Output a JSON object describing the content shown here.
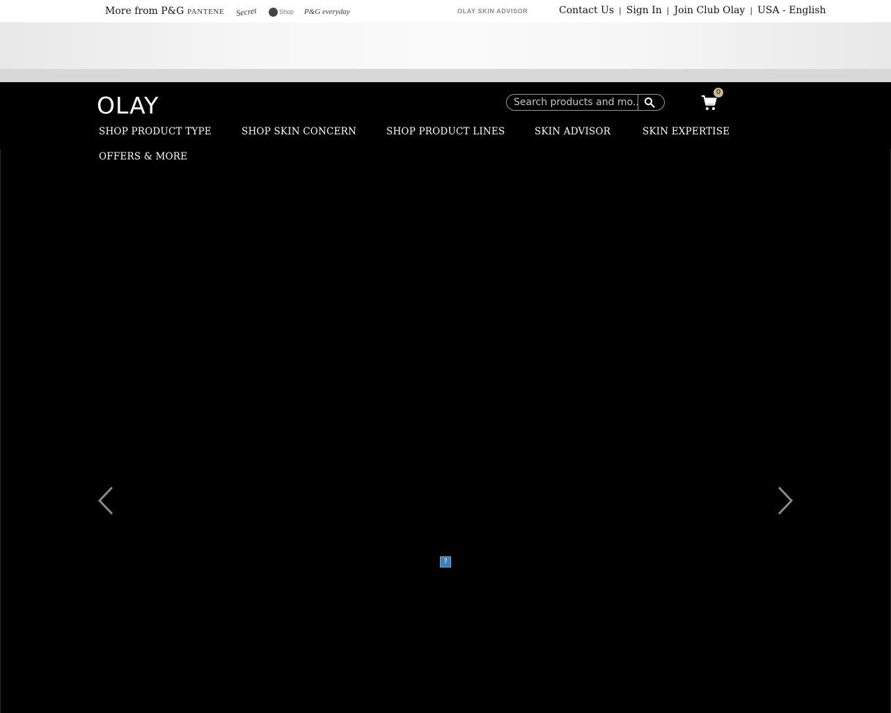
{
  "utility_bar": {
    "more_from": "More from P&G",
    "brands": [
      "PANTENE",
      "Secret",
      "Shop",
      "P&G everyday"
    ],
    "skin_advisor": "OLAY SKIN ADVISOR",
    "links": [
      "Contact Us",
      "Sign In",
      "Join Club Olay",
      "USA - English"
    ],
    "separator": "|"
  },
  "header": {
    "logo": "OLAY",
    "search": {
      "placeholder": "Search products and mo..."
    },
    "cart": {
      "count": "0"
    }
  },
  "nav": {
    "items": [
      "SHOP PRODUCT TYPE",
      "SHOP SKIN CONCERN",
      "SHOP PRODUCT LINES",
      "SKIN ADVISOR",
      "SKIN EXPERTISE",
      "OFFERS & MORE"
    ]
  },
  "hero": {
    "broken_image_glyph": "?"
  },
  "colors": {
    "header_bg": "#000000",
    "utility_bg": "#ffffff",
    "cart_badge": "#c9b98a"
  }
}
